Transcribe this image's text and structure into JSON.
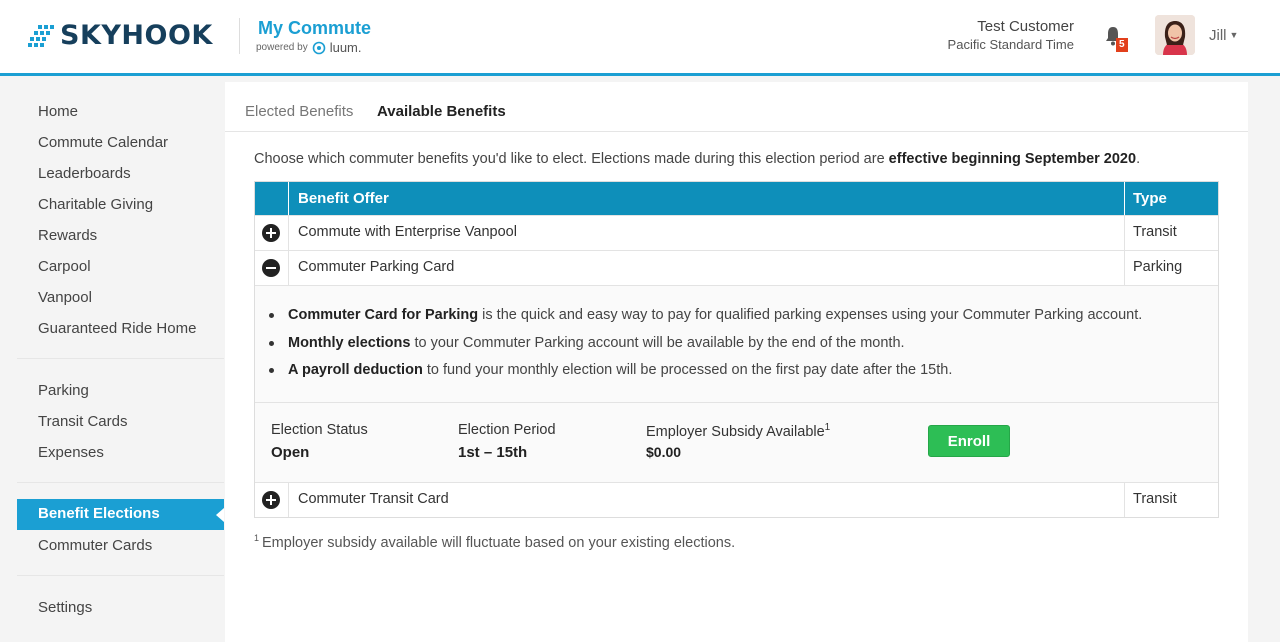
{
  "header": {
    "brand": "SKYHOOK",
    "app_title": "My Commute",
    "powered_by": "powered by",
    "partner": "luum.",
    "user_name": "Test Customer",
    "timezone": "Pacific Standard Time",
    "notifications_count": "5",
    "user_menu_label": "Jill",
    "brand_color": "#1b9fd3"
  },
  "sidebar": {
    "group1": [
      "Home",
      "Commute Calendar",
      "Leaderboards",
      "Charitable Giving",
      "Rewards",
      "Carpool",
      "Vanpool",
      "Guaranteed Ride Home"
    ],
    "group2": [
      "Parking",
      "Transit Cards",
      "Expenses"
    ],
    "active": "Benefit Elections",
    "group3_rest": [
      "Commuter Cards"
    ],
    "group4": [
      "Settings"
    ]
  },
  "tabs": {
    "elected": "Elected Benefits",
    "available": "Available Benefits"
  },
  "intro": {
    "text": "Choose which commuter benefits you'd like to elect. Elections made during this election period are ",
    "bold": "effective beginning September 2020",
    "end": "."
  },
  "table": {
    "col_offer": "Benefit Offer",
    "col_type": "Type",
    "rows": [
      {
        "name": "Commute with Enterprise Vanpool",
        "type": "Transit",
        "expanded": false
      },
      {
        "name": "Commuter Parking Card",
        "type": "Parking",
        "expanded": true
      },
      {
        "name": "Commuter Transit Card",
        "type": "Transit",
        "expanded": false
      }
    ],
    "details": [
      {
        "bold": "Commuter Card for Parking",
        "text": " is the quick and easy way to pay for qualified parking expenses using your Commuter Parking account."
      },
      {
        "bold": "Monthly elections",
        "text": " to your Commuter Parking account will be available by the end of the month."
      },
      {
        "bold": "A payroll deduction",
        "text": " to fund your monthly election will be processed on the first pay date after the 15th."
      }
    ],
    "status": {
      "status_label": "Election Status",
      "status_value": "Open",
      "period_label": "Election Period",
      "period_value": "1st – 15th",
      "subsidy_label": "Employer Subsidy Available",
      "subsidy_sup": "1",
      "subsidy_value": "$0.00",
      "enroll_label": "Enroll"
    }
  },
  "footnote": {
    "sup": "1",
    "text": "Employer subsidy available will fluctuate based on your existing elections."
  }
}
